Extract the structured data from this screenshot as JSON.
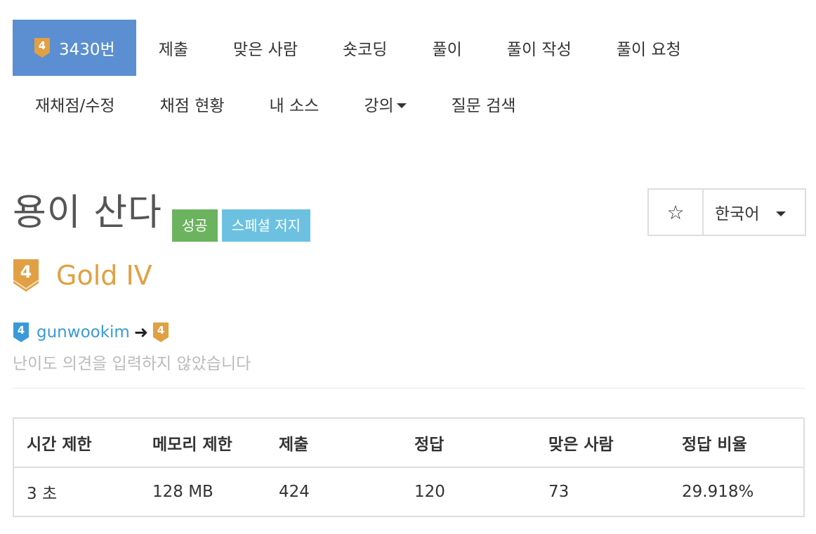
{
  "nav": {
    "problem_tab": "3430번",
    "row1": [
      "제출",
      "맞은 사람",
      "숏코딩",
      "풀이",
      "풀이 작성",
      "풀이 요청"
    ],
    "row2": [
      "재채점/수정",
      "채점 현황",
      "내 소스",
      "강의",
      "질문 검색"
    ]
  },
  "problem": {
    "title": "용이 산다",
    "labels": [
      "성공",
      "스페셜 저지"
    ],
    "tier_digit": "4",
    "tier_name": "Gold IV",
    "tier_color": "#e0a043"
  },
  "actions": {
    "star_icon": "☆",
    "language": "한국어"
  },
  "contribution": {
    "user_tier_digit": "4",
    "user_tier_color": "#3a9ad9",
    "username": "gunwookim",
    "arrow": "➜",
    "target_tier_digit": "4",
    "no_opinion_text": "난이도 의견을 입력하지 않았습니다"
  },
  "table": {
    "headers": [
      "시간 제한",
      "메모리 제한",
      "제출",
      "정답",
      "맞은 사람",
      "정답 비율"
    ],
    "rows": [
      [
        "3 초",
        "128 MB",
        "424",
        "120",
        "73",
        "29.918%"
      ]
    ]
  }
}
